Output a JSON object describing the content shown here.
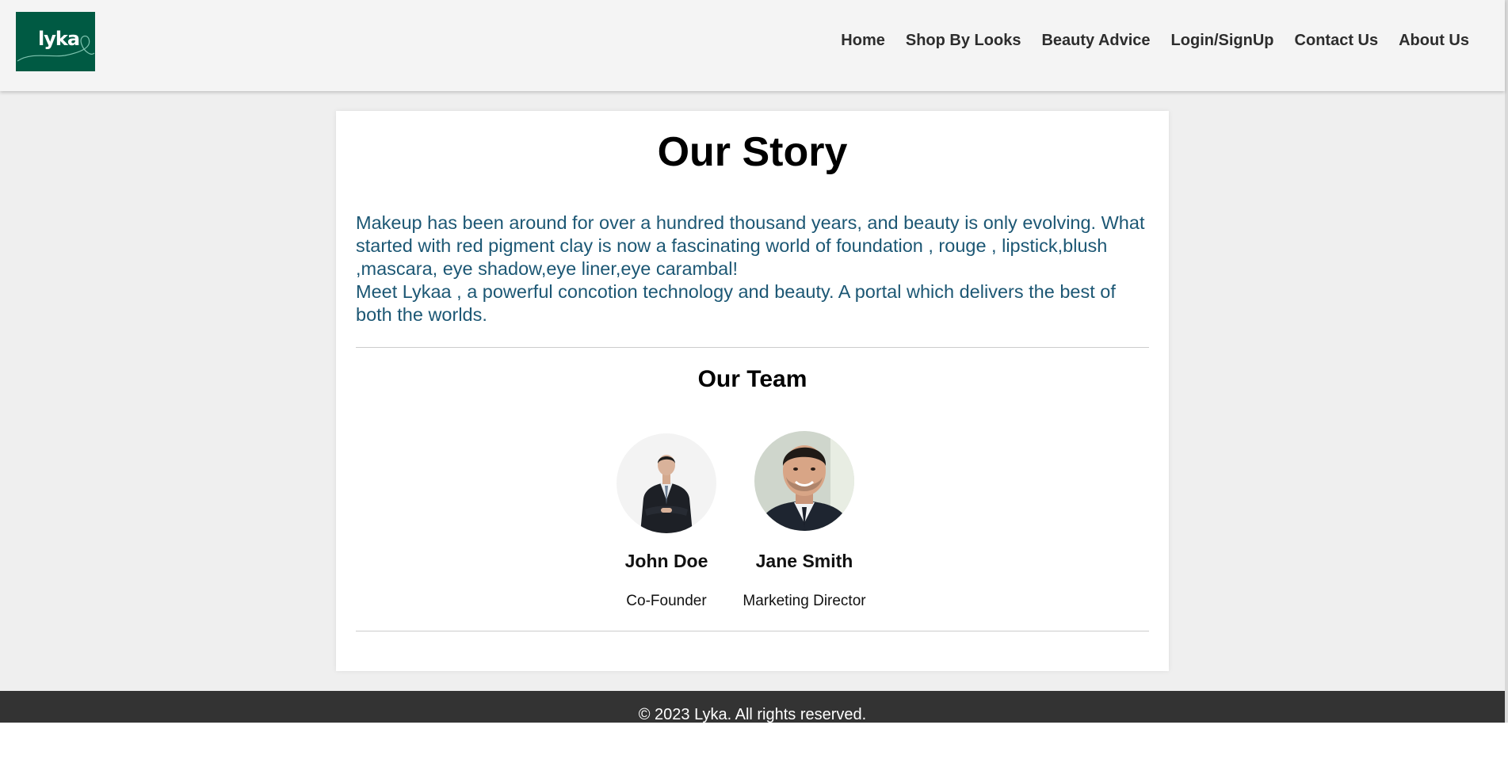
{
  "brand": {
    "logo_text": "lyka",
    "logo_color": "#005a43"
  },
  "nav": {
    "items": [
      {
        "label": "Home"
      },
      {
        "label": "Shop By Looks"
      },
      {
        "label": "Beauty Advice"
      },
      {
        "label": "Login/SignUp"
      },
      {
        "label": "Contact Us"
      },
      {
        "label": "About Us"
      }
    ]
  },
  "story": {
    "title": "Our Story",
    "paragraph_lines": [
      "Makeup has been around for over a hundred thousand years, and beauty is only evolving. What started with red pigment clay is now a fascinating world of foundation , rouge , lipstick,blush ,mascara, eye shadow,eye liner,eye carambal!",
      "Meet Lykaa , a powerful concotion technology and beauty. A portal which delivers the best of both the worlds."
    ],
    "text_color": "#1c5774"
  },
  "team": {
    "title": "Our Team",
    "members": [
      {
        "name": "John Doe",
        "role": "Co-Founder",
        "avatar": "person-photo-icon"
      },
      {
        "name": "Jane Smith",
        "role": "Marketing Director",
        "avatar": "person-photo-icon"
      }
    ]
  },
  "footer": {
    "text": "© 2023 Lyka. All rights reserved."
  }
}
